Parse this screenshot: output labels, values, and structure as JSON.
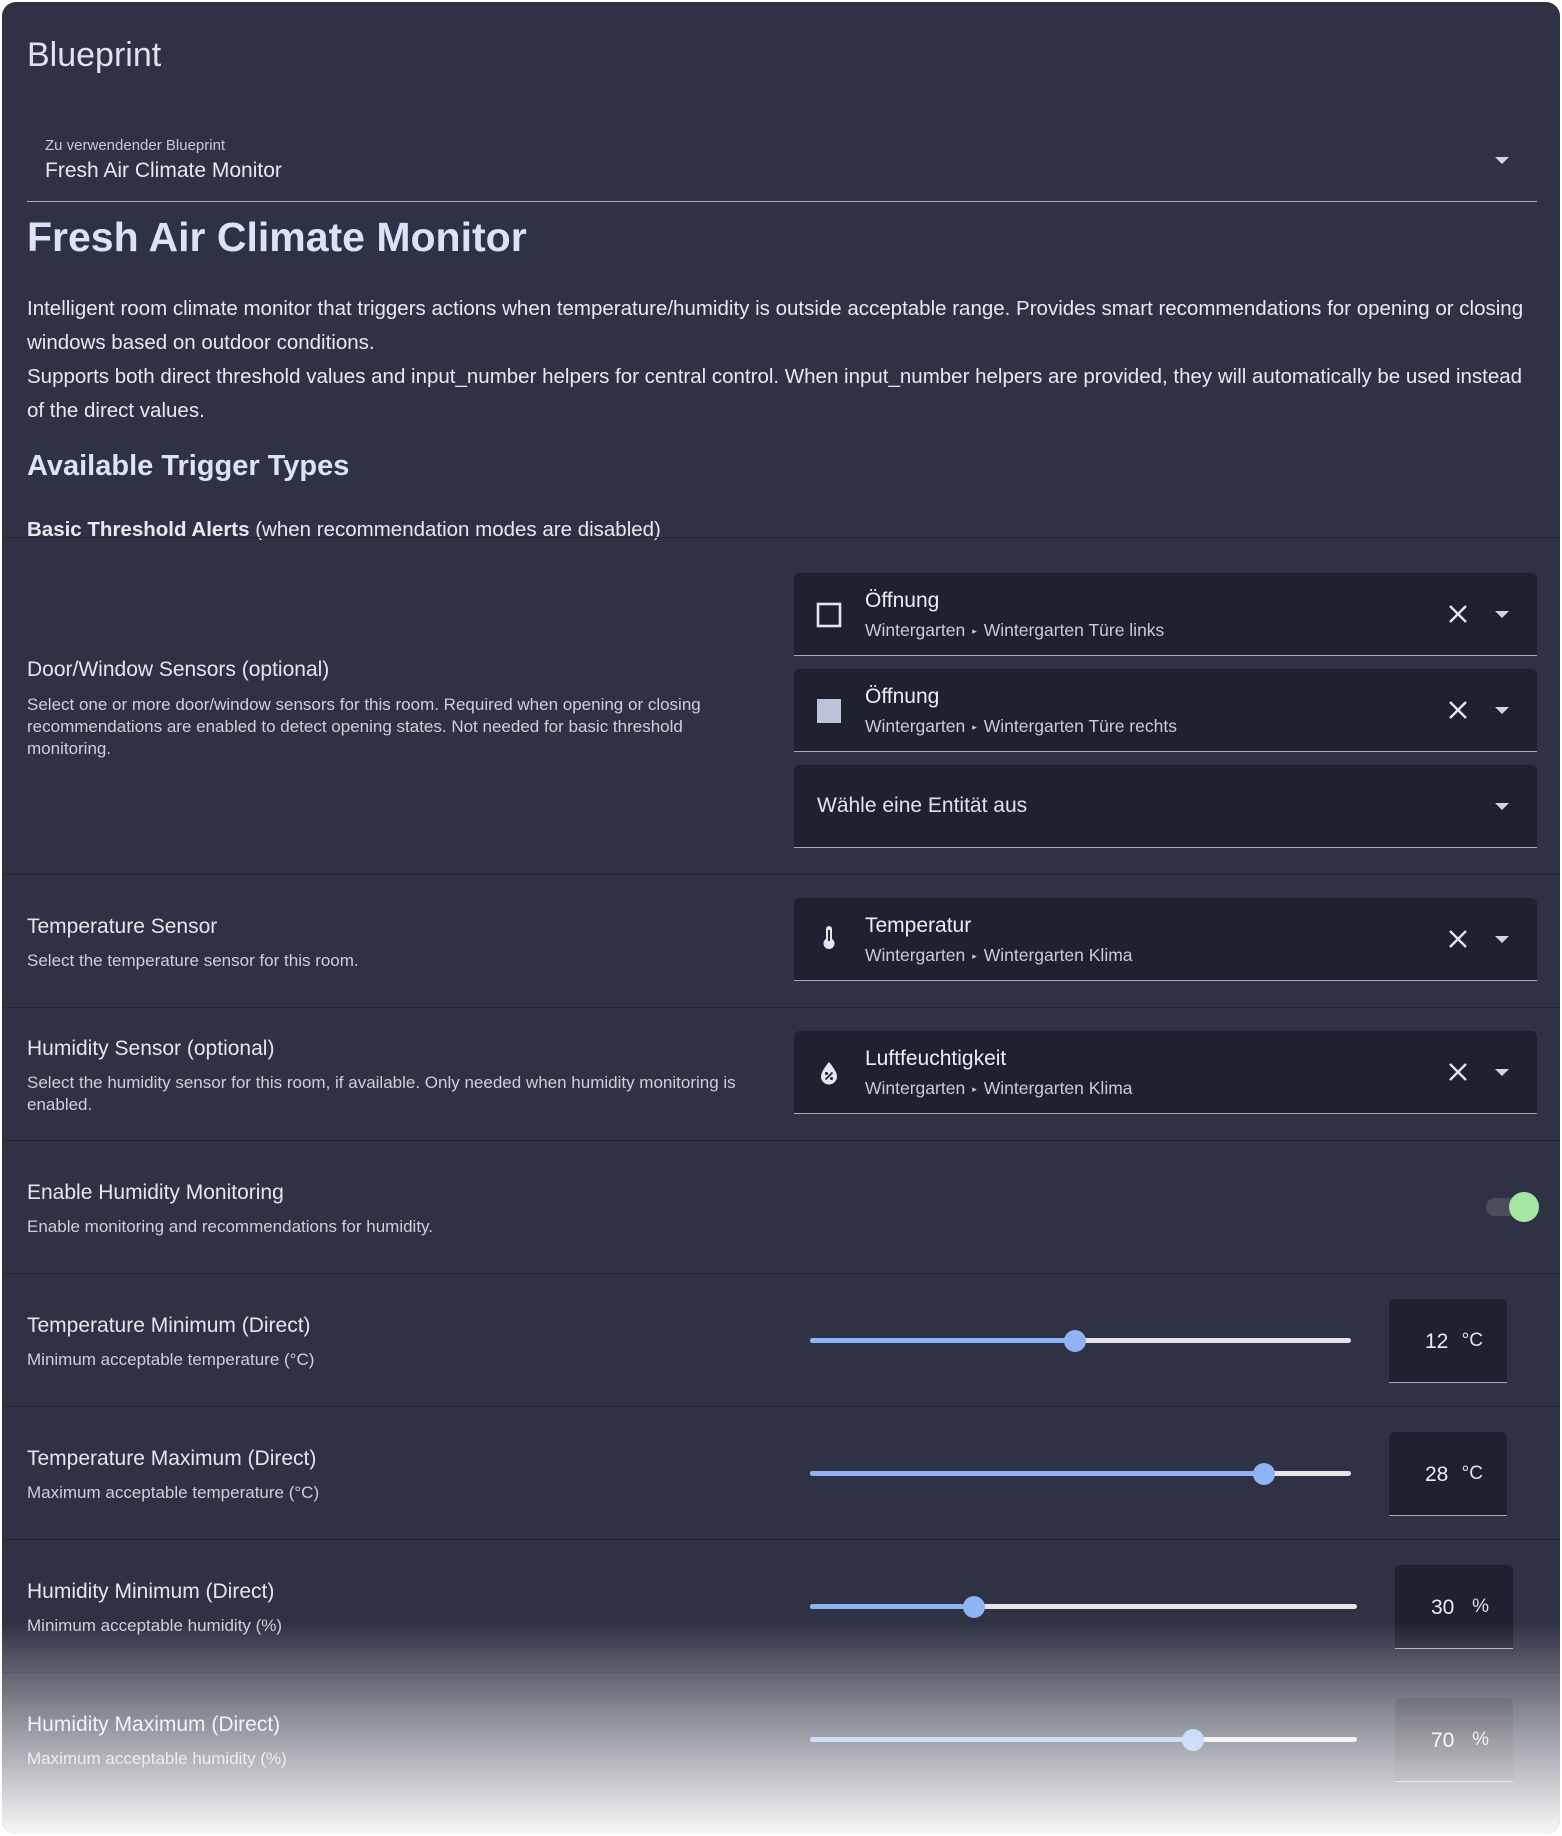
{
  "card": {
    "title": "Blueprint"
  },
  "blueprint_select": {
    "label": "Zu verwendender Blueprint",
    "value": "Fresh Air Climate Monitor"
  },
  "blueprint": {
    "name": "Fresh Air Climate Monitor",
    "description_1": "Intelligent room climate monitor that triggers actions when temperature/humidity is outside acceptable range. Provides smart recommendations for opening or closing windows based on outdoor conditions.",
    "description_2": "Supports both direct threshold values and input_number helpers for central control. When input_number helpers are provided, they will automatically be used instead of the direct values.",
    "section_heading": "Available Trigger Types",
    "basic_bold": "Basic Threshold Alerts",
    "basic_rest": " (when recommendation modes are disabled)"
  },
  "door_window": {
    "label": "Door/Window Sensors (optional)",
    "description": "Select one or more door/window sensors for this room. Required when opening or closing recommendations are enabled to detect opening states. Not needed for basic threshold monitoring.",
    "entities": [
      {
        "name": "Öffnung",
        "area": "Wintergarten",
        "device": "Wintergarten Türe links",
        "icon": "door-closed-icon"
      },
      {
        "name": "Öffnung",
        "area": "Wintergarten",
        "device": "Wintergarten Türe rechts",
        "icon": "door-open-icon"
      }
    ],
    "placeholder": "Wähle eine Entität aus"
  },
  "temperature_sensor": {
    "label": "Temperature Sensor",
    "description": "Select the temperature sensor for this room.",
    "entity": {
      "name": "Temperatur",
      "area": "Wintergarten",
      "device": "Wintergarten Klima",
      "icon": "thermometer-icon"
    }
  },
  "humidity_sensor": {
    "label": "Humidity Sensor (optional)",
    "description": "Select the humidity sensor for this room, if available. Only needed when humidity monitoring is enabled.",
    "entity": {
      "name": "Luftfeuchtigkeit",
      "area": "Wintergarten",
      "device": "Wintergarten Klima",
      "icon": "water-percent-icon"
    }
  },
  "enable_humidity": {
    "label": "Enable Humidity Monitoring",
    "description": "Enable monitoring and recommendations for humidity.",
    "enabled": true
  },
  "sliders": [
    {
      "label": "Temperature Minimum (Direct)",
      "description": "Minimum acceptable temperature (°C)",
      "value": "12",
      "unit": "°C",
      "fraction": 0.49
    },
    {
      "label": "Temperature Maximum (Direct)",
      "description": "Maximum acceptable temperature (°C)",
      "value": "28",
      "unit": "°C",
      "fraction": 0.84
    },
    {
      "label": "Humidity Minimum (Direct)",
      "description": "Minimum acceptable humidity (%)",
      "value": "30",
      "unit": "%",
      "fraction": 0.3
    },
    {
      "label": "Humidity Maximum (Direct)",
      "description": "Maximum acceptable humidity (%)",
      "value": "70",
      "unit": "%",
      "fraction": 0.7
    }
  ],
  "colors": {
    "card_bg": "#2f3244",
    "field_bg": "#1f2130",
    "accent": "#8fb3f3",
    "toggle_on": "#a5e6a3",
    "heading": "#dbe3fa"
  }
}
